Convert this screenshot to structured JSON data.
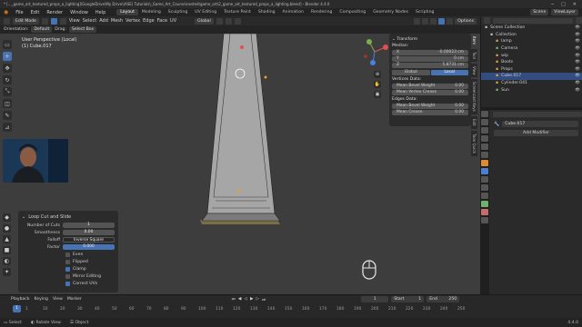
{
  "title_bar": {
    "text": "* [..._game_art_textured_props_a_lighting]\\GoogleDrive\\My Drive\\(ASE) Tutorials\\_Game_Art_Course\\nested\\game_art\\2_game_art_textured_props_a_lighting.blend] - Blender 4.4.0"
  },
  "menu": [
    "File",
    "Edit",
    "Render",
    "Window",
    "Help"
  ],
  "workspaces": [
    "Layout",
    "Modeling",
    "Sculpting",
    "UV Editing",
    "Texture Paint",
    "Shading",
    "Animation",
    "Rendering",
    "Compositing",
    "Geometry Nodes",
    "Scripting"
  ],
  "active_workspace": "Layout",
  "scene": {
    "label": "Scene",
    "view_layer": "ViewLayer"
  },
  "header": {
    "mode": "Edit Mode",
    "menus": [
      "View",
      "Select",
      "Add",
      "Mesh",
      "Vertex",
      "Edge",
      "Face",
      "UV"
    ],
    "transform_orientation": "Global",
    "options": "Options"
  },
  "header2": {
    "orientation_label": "Orientation:",
    "orientation_value": "Default",
    "drag_label": "Drag:",
    "drag_value": "Select Box"
  },
  "viewport": {
    "view_name": "User Perspective (Local)",
    "object_name": "(1) Cube.017"
  },
  "n_panel": {
    "section": "Transform",
    "median_label": "Median:",
    "fields": [
      {
        "axis": "X",
        "value": "-0.00023 cm"
      },
      {
        "axis": "Y",
        "value": "0 cm"
      },
      {
        "axis": "Z",
        "value": "5.8731 cm"
      }
    ],
    "space": [
      "Global",
      "Local"
    ],
    "space_active": "Local",
    "vertex_data": "Vertices Data:",
    "vertex_fields": [
      {
        "label": "Mean Bevel Weight",
        "value": "0.00"
      },
      {
        "label": "Mean Vertex Crease",
        "value": "0.00"
      }
    ],
    "edge_data": "Edges Data:",
    "edge_fields": [
      {
        "label": "Mean Bevel Weight",
        "value": "0.00"
      },
      {
        "label": "Mean Crease",
        "value": "0.00"
      }
    ]
  },
  "side_tabs": [
    "Item",
    "Tool",
    "View",
    "Screencast Keys",
    "Edit",
    "Toon Quick"
  ],
  "operator_panel": {
    "title": "Loop Cut and Slide",
    "fields": [
      {
        "label": "Number of Cuts",
        "value": "1",
        "style": ""
      },
      {
        "label": "Smoothness",
        "value": "0.00",
        "style": ""
      },
      {
        "label": "Falloff",
        "value": "Inverse Square",
        "style": "dark"
      },
      {
        "label": "Factor",
        "value": "0.000",
        "style": "blue"
      }
    ],
    "checks": [
      {
        "label": "Even",
        "on": false
      },
      {
        "label": "Flipped",
        "on": false
      },
      {
        "label": "Clamp",
        "on": true
      },
      {
        "label": "Mirror Editing",
        "on": false
      },
      {
        "label": "Correct UVs",
        "on": true
      }
    ]
  },
  "outliner": {
    "rows": [
      {
        "name": "Scene Collection",
        "indent": 0,
        "color": "#bbbbbb",
        "sel": false
      },
      {
        "name": "Collection",
        "indent": 1,
        "color": "#bbbbbb",
        "sel": false
      },
      {
        "name": "lamp",
        "indent": 2,
        "color": "#dda04a",
        "sel": false
      },
      {
        "name": "Camera",
        "indent": 2,
        "color": "#74b26e",
        "sel": false
      },
      {
        "name": "wip",
        "indent": 2,
        "color": "#dda04a",
        "sel": false
      },
      {
        "name": "Boots",
        "indent": 2,
        "color": "#dda04a",
        "sel": false
      },
      {
        "name": "Props",
        "indent": 2,
        "color": "#dda04a",
        "sel": false
      },
      {
        "name": "Cube.017",
        "indent": 2,
        "color": "#dda04a",
        "sel": true
      },
      {
        "name": "Cylinder.041",
        "indent": 2,
        "color": "#dda04a",
        "sel": false
      },
      {
        "name": "Sun",
        "indent": 2,
        "color": "#74b26e",
        "sel": false
      }
    ]
  },
  "properties": {
    "object_name": "Cube.017",
    "add_modifier": "Add Modifier"
  },
  "timeline": {
    "menus": [
      "Playback",
      "Keying",
      "View",
      "Marker"
    ],
    "current_frame": "1",
    "start_label": "Start",
    "start": "1",
    "end_label": "End",
    "end": "250",
    "ruler": [
      "1",
      "10",
      "20",
      "30",
      "40",
      "50",
      "60",
      "70",
      "80",
      "90",
      "100",
      "110",
      "120",
      "130",
      "140",
      "150",
      "160",
      "170",
      "180",
      "190",
      "200",
      "210",
      "220",
      "230",
      "240",
      "250"
    ]
  },
  "status": [
    "Select",
    "Rotate View",
    "Object"
  ],
  "version": "4.4.0",
  "colors": {
    "accent": "#4772b3",
    "viewport": "#3d3d3d",
    "panel": "#2b2b2b"
  }
}
